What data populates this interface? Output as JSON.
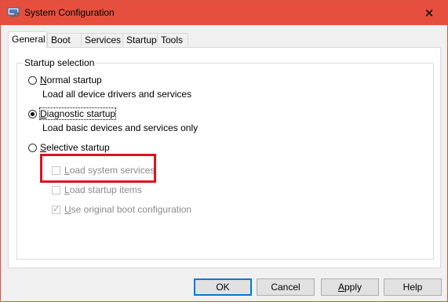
{
  "window": {
    "title": "System Configuration",
    "close_glyph": "✕",
    "title_bar_color": "#e64f3d"
  },
  "tabs": [
    {
      "label": "General",
      "active": true
    },
    {
      "label": "Boot",
      "active": false
    },
    {
      "label": "Services",
      "active": false
    },
    {
      "label": "Startup",
      "active": false
    },
    {
      "label": "Tools",
      "active": false
    }
  ],
  "startup_selection": {
    "group_label": "Startup selection",
    "normal": {
      "label_prefix": "N",
      "label_rest": "ormal startup",
      "description": "Load all device drivers and services",
      "selected": false
    },
    "diagnostic": {
      "label_prefix": "D",
      "label_rest": "iagnostic startup",
      "description": "Load basic devices and services only",
      "selected": true
    },
    "selective": {
      "label_prefix": "S",
      "label_rest": "elective startup",
      "selected": false,
      "options": [
        {
          "label_prefix": "L",
          "label_rest": "oad system services",
          "checked": false
        },
        {
          "label_prefix": "L",
          "label_rest": "oad startup items",
          "checked": false
        },
        {
          "label_prefix": "U",
          "label_rest": "se original boot configuration",
          "checked": true
        }
      ]
    }
  },
  "buttons": {
    "ok": "OK",
    "cancel": "Cancel",
    "apply_prefix": "A",
    "apply_rest": "pply",
    "help": "Help"
  },
  "highlight_color": "#e01020"
}
